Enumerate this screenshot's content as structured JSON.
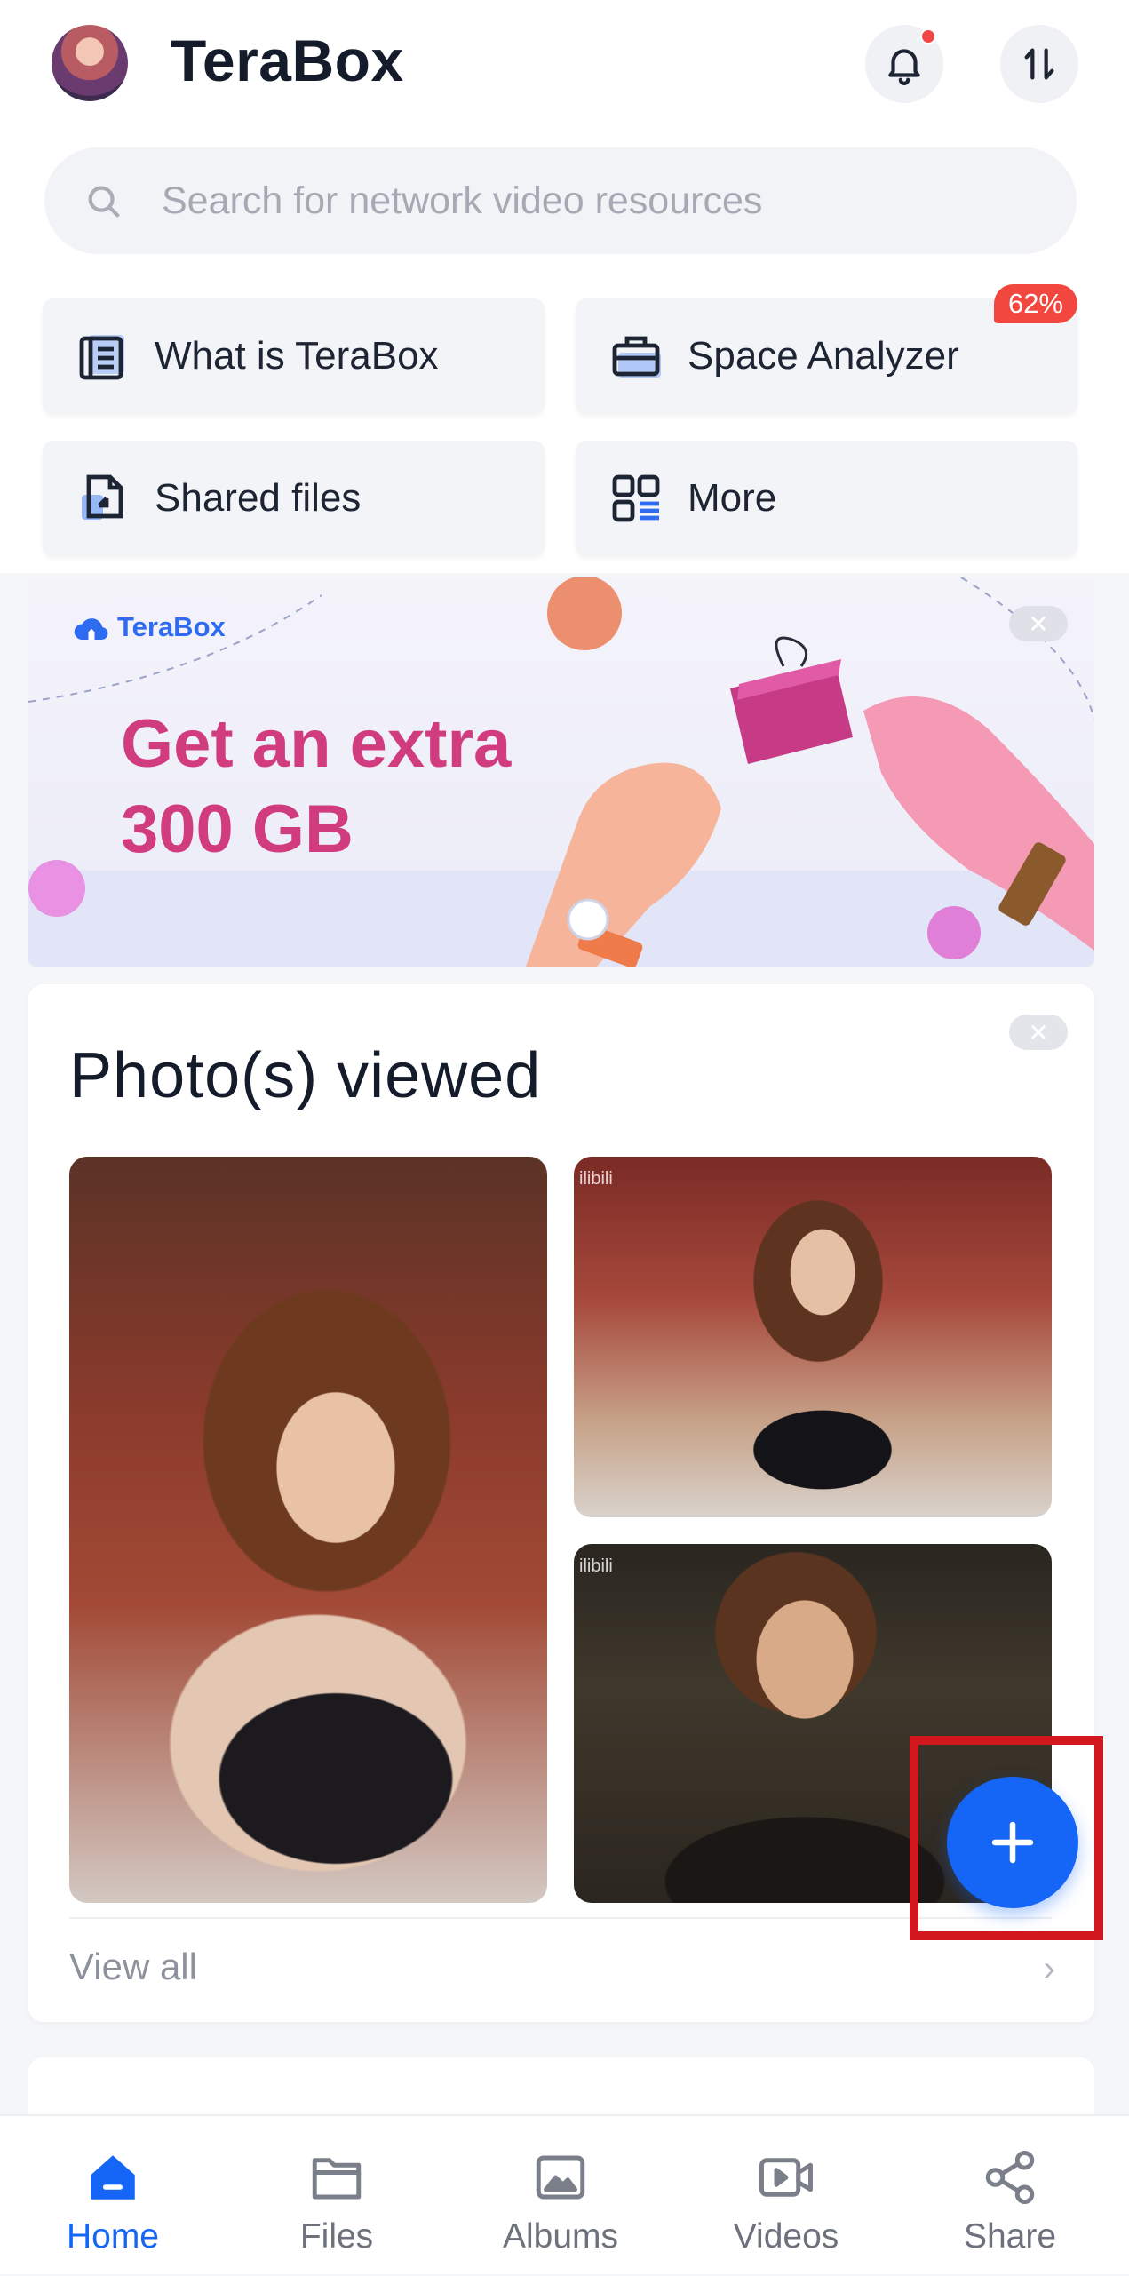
{
  "header": {
    "title": "TeraBox",
    "avatar_icon": "avatar-icon",
    "bell_icon": "bell-icon",
    "transfer_icon": "transfer-icon"
  },
  "search": {
    "placeholder": "Search for network video resources"
  },
  "quick_tiles": [
    {
      "label": "What is TeraBox",
      "icon": "document-icon"
    },
    {
      "label": "Space Analyzer",
      "icon": "briefcase-icon",
      "badge": "62%"
    },
    {
      "label": "Shared files",
      "icon": "shared-file-icon"
    },
    {
      "label": "More",
      "icon": "grid-icon"
    }
  ],
  "banner": {
    "brand": "TeraBox",
    "headline_line1": "Get an extra",
    "headline_line2": "300 GB"
  },
  "photos_card": {
    "title": "Photo(s) viewed",
    "watermark": "ilibili",
    "view_all": "View all"
  },
  "bottom_nav": [
    {
      "label": "Home",
      "icon": "home-icon",
      "active": true
    },
    {
      "label": "Files",
      "icon": "folder-icon",
      "active": false
    },
    {
      "label": "Albums",
      "icon": "image-icon",
      "active": false
    },
    {
      "label": "Videos",
      "icon": "video-icon",
      "active": false
    },
    {
      "label": "Share",
      "icon": "share-icon",
      "active": false
    }
  ],
  "colors": {
    "accent": "#1566f6",
    "badge": "#f1473f",
    "banner_headline": "#d13c7e",
    "highlight_box": "#d2171e"
  }
}
